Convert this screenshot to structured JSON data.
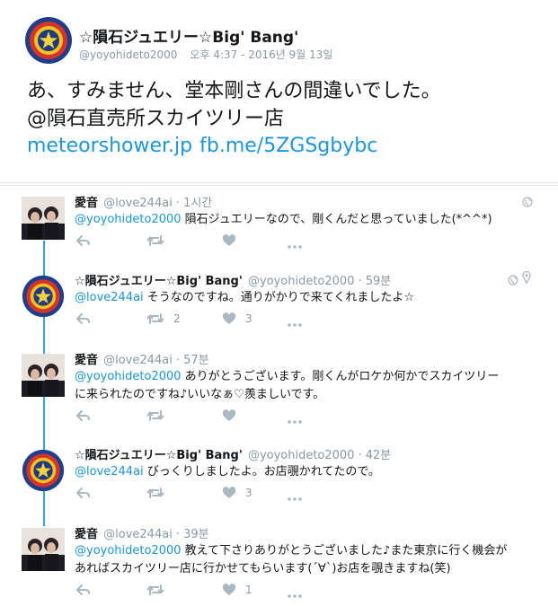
{
  "main_tweet": {
    "display_name": "☆隕石ジュエリー☆Big' Bang'",
    "handle": "@yoyohideto2000",
    "timestamp": "오후 4:37 - 2016년 9월 13일",
    "text_line1": "あ、すみません、堂本剛さんの間違いでした。",
    "text_line2": "@隕石直売所スカイツリー店",
    "link1": "meteorshower.jp",
    "link2": "fb.me/5ZGSgbybc"
  },
  "replies": [
    {
      "display_name": "愛音",
      "handle": "@love244ai",
      "time": "· 1시간",
      "mention": "@yoyohideto2000",
      "text_line1": "隕石ジュエリーなので、剛くんだと思っていました(*^^*)",
      "text_line2": "",
      "retweet_count": "",
      "like_count": ""
    },
    {
      "display_name": "☆隕石ジュエリー☆Big' Bang'",
      "handle": "@yoyohideto2000",
      "time": "· 59분",
      "mention": "@love244ai",
      "text_line1": "そうなのですね。通りがかりで来てくれましたよ☆",
      "text_line2": "",
      "retweet_count": "2",
      "like_count": "3"
    },
    {
      "display_name": "愛音",
      "handle": "@love244ai",
      "time": "· 57분",
      "mention": "@yoyohideto2000",
      "text_line1": "ありがとうございます。剛くんがロケか何かでスカイツリー",
      "text_line2": "に来られたのですね♪いいなぁ♡羨ましいです。",
      "retweet_count": "",
      "like_count": ""
    },
    {
      "display_name": "☆隕石ジュエリー☆Big' Bang'",
      "handle": "@yoyohideto2000",
      "time": "· 42분",
      "mention": "@love244ai",
      "text_line1": "びっくりしましたよ。お店覗かれてたので。",
      "text_line2": "",
      "retweet_count": "",
      "like_count": "3"
    },
    {
      "display_name": "愛音",
      "handle": "@love244ai",
      "time": "· 39분",
      "mention": "@yoyohideto2000",
      "text_line1": "教えて下さりありがとうございました♪また東京に行く機会が",
      "text_line2": "あればスカイツリー店に行かせてもらいます(´∀`)お店を覗きますね(笑)",
      "retweet_count": "",
      "like_count": "1"
    }
  ],
  "colors": {
    "link": "#1b95e0",
    "muted": "#8899a6",
    "icon": "#aab8c2",
    "thread": "#2aa9e0"
  }
}
